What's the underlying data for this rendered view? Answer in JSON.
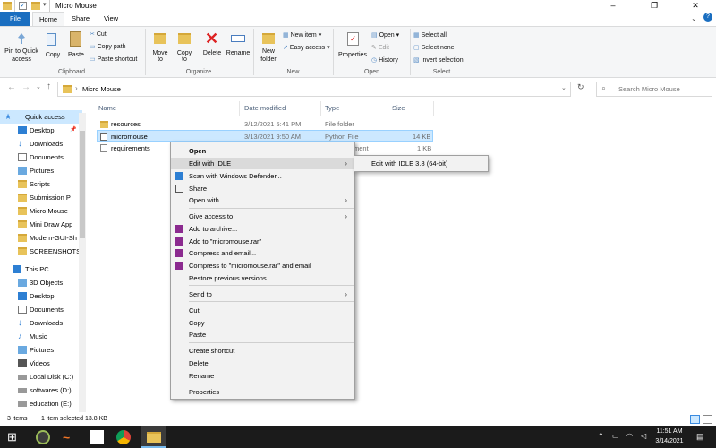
{
  "window": {
    "title": "Micro Mouse",
    "minimize": "–",
    "maximize": "❐",
    "close": "✕"
  },
  "tabs": [
    {
      "label": "File"
    },
    {
      "label": "Home"
    },
    {
      "label": "Share"
    },
    {
      "label": "View"
    }
  ],
  "ribbon": {
    "clipboard": {
      "pin": "Pin to Quick access",
      "pin_line1": "Pin to Quick",
      "pin_line2": "access",
      "copy": "Copy",
      "paste": "Paste",
      "cut": "Cut",
      "copy_path": "Copy path",
      "paste_shortcut": "Paste shortcut",
      "label": "Clipboard"
    },
    "organize": {
      "move_to": "Move to",
      "copy_to": "Copy to",
      "delete": "Delete",
      "rename": "Rename",
      "label": "Organize"
    },
    "new": {
      "new_folder_line1": "New",
      "new_folder_line2": "folder",
      "new_item": "New item ▾",
      "easy_access": "Easy access ▾",
      "label": "New"
    },
    "open": {
      "properties": "Properties",
      "open": "Open ▾",
      "edit": "Edit",
      "history": "History",
      "label": "Open"
    },
    "select": {
      "select_all": "Select all",
      "select_none": "Select none",
      "invert": "Invert selection",
      "label": "Select"
    }
  },
  "address": {
    "path": "Micro Mouse",
    "search_placeholder": "Search Micro Mouse"
  },
  "nav": {
    "quick_access": "Quick access",
    "quick_items": [
      "Desktop",
      "Downloads",
      "Documents",
      "Pictures",
      "Scripts",
      "Submission P",
      "Micro Mouse",
      "Mini Draw App",
      "Modern-GUI-Sh",
      "SCREENSHOTS"
    ],
    "this_pc": "This PC",
    "pc_items": [
      "3D Objects",
      "Desktop",
      "Documents",
      "Downloads",
      "Music",
      "Pictures",
      "Videos",
      "Local Disk (C:)",
      "softwares (D:)",
      "education (E:)"
    ]
  },
  "list": {
    "headers": {
      "name": "Name",
      "date": "Date modified",
      "type": "Type",
      "size": "Size"
    },
    "rows": [
      {
        "name": "resources",
        "date": "3/12/2021 5:41 PM",
        "type": "File folder",
        "size": ""
      },
      {
        "name": "micromouse",
        "date": "3/13/2021 9:50 AM",
        "type": "Python File",
        "size": "14 KB"
      },
      {
        "name": "requirements",
        "date": "",
        "type": "ment",
        "size": "1 KB"
      }
    ]
  },
  "context_menu": {
    "items": [
      {
        "label": "Open"
      },
      {
        "label": "Edit with IDLE"
      },
      {
        "label": "Scan with Windows Defender..."
      },
      {
        "label": "Share"
      },
      {
        "label": "Open with"
      },
      {
        "label": "Give access to"
      },
      {
        "label": "Add to archive..."
      },
      {
        "label": "Add to \"micromouse.rar\""
      },
      {
        "label": "Compress and email..."
      },
      {
        "label": "Compress to \"micromouse.rar\" and email"
      },
      {
        "label": "Restore previous versions"
      },
      {
        "label": "Send to"
      },
      {
        "label": "Cut"
      },
      {
        "label": "Copy"
      },
      {
        "label": "Paste"
      },
      {
        "label": "Create shortcut"
      },
      {
        "label": "Delete"
      },
      {
        "label": "Rename"
      },
      {
        "label": "Properties"
      }
    ],
    "submenu": "Edit with IDLE 3.8 (64-bit)"
  },
  "status": {
    "items": "3 items",
    "selected": "1 item selected  13.8 KB"
  },
  "taskbar": {
    "time": "11:51 AM",
    "date": "3/14/2021"
  },
  "colors": {
    "accent": "#1a6ec0",
    "selection": "#cce8ff",
    "folder": "#e8c35a"
  }
}
